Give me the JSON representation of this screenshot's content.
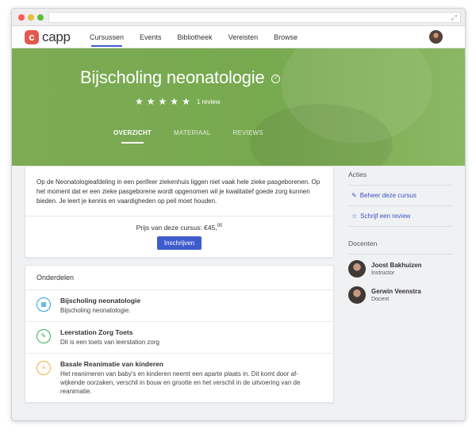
{
  "brand": {
    "name": "capp",
    "mark": "c",
    "accent": "#3f5ccf",
    "logo_color": "#e2594f"
  },
  "nav": {
    "items": [
      {
        "label": "Cursussen",
        "active": true
      },
      {
        "label": "Events",
        "active": false
      },
      {
        "label": "Bibliotheek",
        "active": false
      },
      {
        "label": "Vereisten",
        "active": false
      },
      {
        "label": "Browse",
        "active": false
      }
    ]
  },
  "hero": {
    "title": "Bijscholing neonatologie",
    "rating": 5,
    "review_count": "1 review",
    "tabs": [
      {
        "label": "OVERZICHT",
        "active": true
      },
      {
        "label": "MATERIAAL",
        "active": false
      },
      {
        "label": "REVIEWS",
        "active": false
      }
    ],
    "background_color": "#7cab54"
  },
  "course": {
    "description": "Op de Neonatologieafdeling in een perifeer ziekenhuis liggen niet vaak hele zieke pasgeborenen. Op het moment dat er een zieke pasgeborene wordt opgenomen wil je kwalitatief goede zorg kunnen bieden. Je leert je kennis en vaardigheden op peil moet houden.",
    "price_label": "Prijs van deze cursus: €45,",
    "price_cents": "00",
    "enroll_label": "Inschrijven"
  },
  "sections": {
    "heading": "Onderdelen",
    "items": [
      {
        "title": "Bijscholing neonatologie",
        "description": "Bijscholing neonatologie.",
        "icon": "calendar-icon",
        "color": "#2f9ee0"
      },
      {
        "title": "Leerstation Zorg Toets",
        "description": "Dit is een toets van leerstation zorg",
        "icon": "edit-icon",
        "color": "#33b05a"
      },
      {
        "title": "Basale Reanimatie van kinderen",
        "description": "Het reanimeren van baby's en kinderen neemt een aparte plaats in. Dit komt door af-wijkende oorzaken, verschil in bouw en grootte en het verschil in de uitvoering van de reanimatie.",
        "icon": "document-icon",
        "color": "#f0b035"
      }
    ]
  },
  "sidebar": {
    "actions_heading": "Acties",
    "actions": [
      {
        "label": "Beheer deze cursus",
        "icon": "pencil-icon"
      },
      {
        "label": "Schrijf een review",
        "icon": "star-outline-icon"
      }
    ],
    "teachers_heading": "Docenten",
    "teachers": [
      {
        "name": "Joost Bakhuizen",
        "role": "Instructor"
      },
      {
        "name": "Gerwin Veenstra",
        "role": "Docent"
      }
    ]
  }
}
